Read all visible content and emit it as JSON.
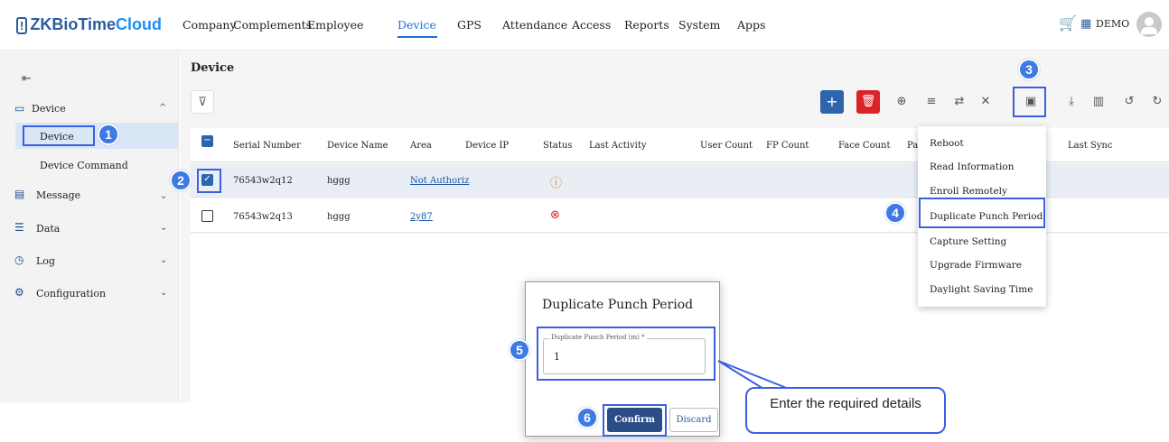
{
  "app": {
    "logo": "ZKBioTime",
    "logo_cloud": "Cloud"
  },
  "nav": [
    "Company",
    "Complements",
    "Employee",
    "Device",
    "GPS",
    "Attendance",
    "Access",
    "Reports",
    "System",
    "Apps"
  ],
  "user": {
    "name": "DEMO"
  },
  "sidebar": {
    "device_group": "Device",
    "device_item": "Device",
    "device_command": "Device Command",
    "message": "Message",
    "data": "Data",
    "log": "Log",
    "configuration": "Configuration"
  },
  "page_title": "Device",
  "table": {
    "headers": [
      "Serial Number",
      "Device Name",
      "Area",
      "Device IP",
      "Status",
      "Last Activity",
      "User Count",
      "FP Count",
      "Face Count",
      "Pal",
      "Last Sync"
    ],
    "rows": [
      {
        "serial": "76543w2q12",
        "name": "hggg",
        "area": "Not Authoriz"
      },
      {
        "serial": "76543w2q13",
        "name": "hggg",
        "area": "2y87"
      }
    ]
  },
  "menu": [
    "Reboot",
    "Read Information",
    "Enroll Remotely",
    "Duplicate Punch Period",
    "Capture Setting",
    "Upgrade Firmware",
    "Daylight Saving Time"
  ],
  "dialog": {
    "title": "Duplicate Punch Period",
    "field_label": "Duplicate Punch Period (m)",
    "required_mark": "*",
    "field_value": "1",
    "confirm": "Confirm",
    "discard": "Discard"
  },
  "callout": "Enter the required details",
  "badges": [
    "1",
    "2",
    "3",
    "4",
    "5",
    "6"
  ],
  "colors": {
    "accent": "#1f6fd6",
    "highlight": "#3c5fe0",
    "badge": "#3f79e4",
    "add_button": "#2d64ad",
    "delete_button": "#d9252a"
  }
}
